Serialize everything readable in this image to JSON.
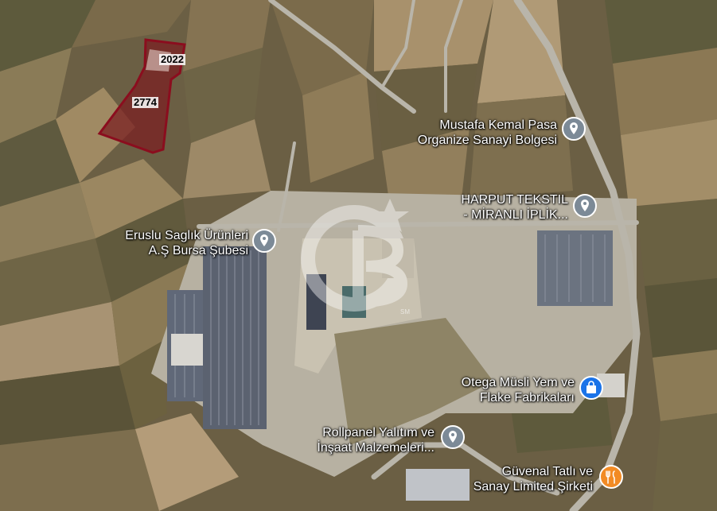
{
  "map": {
    "colors": {
      "parcel_outline": "#8b0d1e",
      "parcel_fill": "#7a1f22",
      "pin_gray": "#7c8a97",
      "pin_blue": "#1a73e8",
      "pin_orange": "#f28b24"
    },
    "parcels": [
      {
        "label": "2022"
      },
      {
        "label": "2774"
      }
    ],
    "pois": [
      {
        "name_line1": "Mustafa Kemal Pasa",
        "name_line2": "Organize Sanayi Bolgesi",
        "icon": "location-pin-icon"
      },
      {
        "name_line1": "HARPUT TEKSTIL",
        "name_line2": "- MİRANLI İPLİK...",
        "icon": "location-pin-icon"
      },
      {
        "name_line1": "Eruslu Saglık Ürünleri",
        "name_line2": "A.Ş Bursa Şubesi",
        "icon": "location-pin-icon"
      },
      {
        "name_line1": "Otega Müsli Yem ve",
        "name_line2": "Flake Fabrikaları",
        "icon": "shopping-bag-icon"
      },
      {
        "name_line1": "Rollpanel Yalıtım ve",
        "name_line2": "İnşaat Malzemeleri...",
        "icon": "location-pin-icon"
      },
      {
        "name_line1": "Güvenal Tatlı ve",
        "name_line2": "Sanay Limited Şirketi",
        "icon": "restaurant-icon"
      }
    ],
    "watermark": {
      "logo": "CB",
      "tag": "SM"
    }
  }
}
